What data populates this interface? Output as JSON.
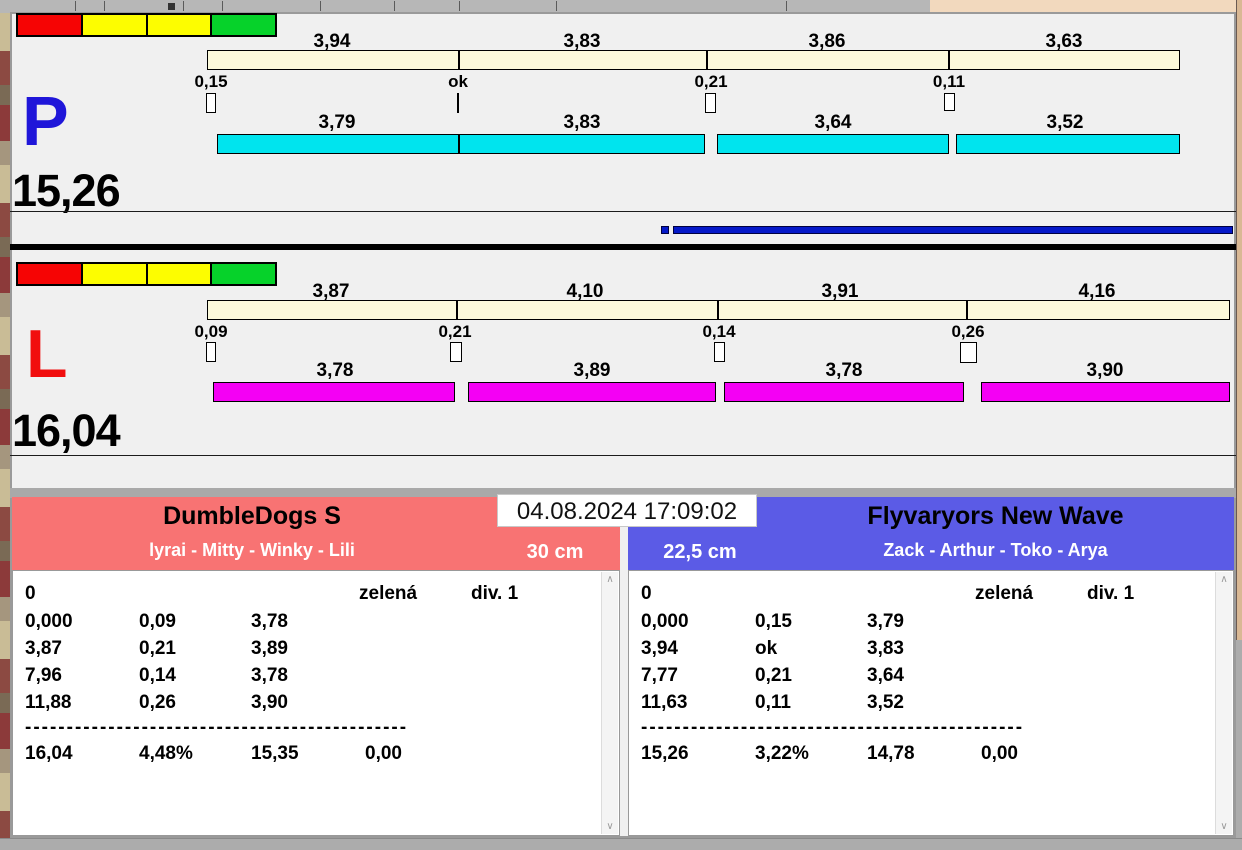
{
  "timestamp": "04.08.2024 17:09:02",
  "start_lights_colors": [
    "#f60404",
    "#fdfd00",
    "#fdfd00",
    "#06d22a"
  ],
  "progress_bar_color": "#0418c8",
  "lanes": {
    "p": {
      "label": "P",
      "label_color": "#1f16d9",
      "total": "15,26",
      "top_times": [
        "3,94",
        "3,83",
        "3,86",
        "3,63"
      ],
      "faults": [
        "0,15",
        "ok",
        "0,21",
        "0,11"
      ],
      "bottom_times": [
        "3,79",
        "3,83",
        "3,64",
        "3,52"
      ],
      "top_bar_color": "#fcfadb",
      "bottom_bar_color": "#00e4ee"
    },
    "l": {
      "label": "L",
      "label_color": "#f10e0e",
      "total": "16,04",
      "top_times": [
        "3,87",
        "4,10",
        "3,91",
        "4,16"
      ],
      "faults": [
        "0,09",
        "0,21",
        "0,14",
        "0,26"
      ],
      "bottom_times": [
        "3,78",
        "3,89",
        "3,78",
        "3,90"
      ],
      "top_bar_color": "#fcfadb",
      "bottom_bar_color": "#f400f4"
    }
  },
  "teams": {
    "left": {
      "name": "DumbleDogs S",
      "lineup": "lyrai - Mitty - Winky - Lili",
      "jump_height": "30 cm",
      "header_color": "#f87373",
      "results": {
        "run": "0",
        "color_label": "zelená",
        "division": "div. 1",
        "rows": [
          {
            "t": "0,000",
            "f": "0,09",
            "s": "3,78"
          },
          {
            "t": "3,87",
            "f": "0,21",
            "s": "3,89"
          },
          {
            "t": "7,96",
            "f": "0,14",
            "s": "3,78"
          },
          {
            "t": "11,88",
            "f": "0,26",
            "s": "3,90"
          }
        ],
        "divider": "----------------------------------------------",
        "summary": {
          "total": "16,04",
          "pct": "4,48%",
          "net": "15,35",
          "penalty": "0,00"
        }
      }
    },
    "right": {
      "name": "Flyvaryors New Wave",
      "lineup": "Zack - Arthur - Toko - Arya",
      "jump_height": "22,5 cm",
      "header_color": "#5b5be6",
      "results": {
        "run": "0",
        "color_label": "zelená",
        "division": "div. 1",
        "rows": [
          {
            "t": "0,000",
            "f": "0,15",
            "s": "3,79"
          },
          {
            "t": "3,94",
            "f": "ok",
            "s": "3,83"
          },
          {
            "t": "7,77",
            "f": "0,21",
            "s": "3,64"
          },
          {
            "t": "11,63",
            "f": "0,11",
            "s": "3,52"
          }
        ],
        "divider": "----------------------------------------------",
        "summary": {
          "total": "15,26",
          "pct": "3,22%",
          "net": "14,78",
          "penalty": "0,00"
        }
      }
    }
  }
}
